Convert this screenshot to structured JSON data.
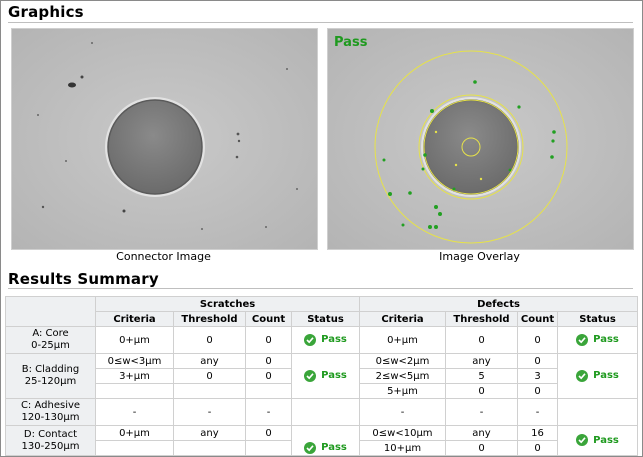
{
  "graphics": {
    "title": "Graphics",
    "connector_caption": "Connector Image",
    "overlay_caption": "Image Overlay",
    "overlay_status": "Pass"
  },
  "results": {
    "title": "Results Summary",
    "group_scratches": "Scratches",
    "group_defects": "Defects",
    "col_criteria": "Criteria",
    "col_threshold": "Threshold",
    "col_count": "Count",
    "col_status": "Status",
    "zones": [
      {
        "name": "A: Core",
        "range": "0-25μm",
        "scratch_rows": [
          {
            "criteria": "0+μm",
            "threshold": "0",
            "count": "0"
          }
        ],
        "scratch_status": "Pass",
        "defect_rows": [
          {
            "criteria": "0+μm",
            "threshold": "0",
            "count": "0"
          }
        ],
        "defect_status": "Pass"
      },
      {
        "name": "B: Cladding",
        "range": "25-120μm",
        "scratch_rows": [
          {
            "criteria": "0≤w<3μm",
            "threshold": "any",
            "count": "0"
          },
          {
            "criteria": "3+μm",
            "threshold": "0",
            "count": "0"
          },
          {
            "criteria": "",
            "threshold": "",
            "count": ""
          }
        ],
        "scratch_status": "Pass",
        "defect_rows": [
          {
            "criteria": "0≤w<2μm",
            "threshold": "any",
            "count": "0"
          },
          {
            "criteria": "2≤w<5μm",
            "threshold": "5",
            "count": "3"
          },
          {
            "criteria": "5+μm",
            "threshold": "0",
            "count": "0"
          }
        ],
        "defect_status": "Pass"
      },
      {
        "name": "C: Adhesive",
        "range": "120-130μm",
        "scratch_rows": [
          {
            "criteria": "-",
            "threshold": "-",
            "count": "-"
          }
        ],
        "scratch_status": "",
        "defect_rows": [
          {
            "criteria": "-",
            "threshold": "-",
            "count": "-"
          }
        ],
        "defect_status": ""
      },
      {
        "name": "D: Contact",
        "range": "130-250μm",
        "scratch_rows": [
          {
            "criteria": "0+μm",
            "threshold": "any",
            "count": "0"
          },
          {
            "criteria": "",
            "threshold": "",
            "count": ""
          }
        ],
        "scratch_status": "Pass",
        "defect_rows": [
          {
            "criteria": "0≤w<10μm",
            "threshold": "any",
            "count": "16"
          },
          {
            "criteria": "10+μm",
            "threshold": "0",
            "count": "0"
          }
        ],
        "defect_status": "Pass"
      }
    ]
  },
  "colors": {
    "pass": "#1f9a1f",
    "overlay_ring": "#e6e24a",
    "defect_mark": "#22a022"
  }
}
